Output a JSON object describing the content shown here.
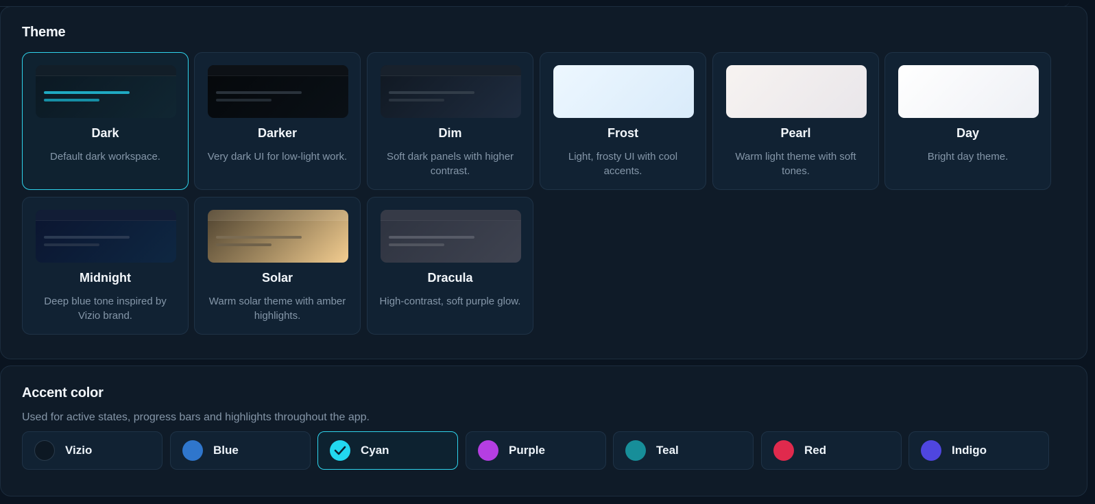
{
  "theme": {
    "title": "Theme",
    "selected": "Dark",
    "cards": [
      {
        "name": "Dark",
        "desc": "Default dark workspace.",
        "bg": "linear-gradient(135deg,#0b1822,#102632)",
        "bar": "#121e28",
        "line": "#1fa9c2",
        "line2": "#168ea5"
      },
      {
        "name": "Darker",
        "desc": "Very dark UI for low-light work.",
        "bg": "linear-gradient(135deg,#05080b,#0a1016)",
        "bar": "#0d1116",
        "line": "#2a323b",
        "line2": "#232b33"
      },
      {
        "name": "Dim",
        "desc": "Soft dark panels with higher contrast.",
        "bg": "linear-gradient(135deg,#101822,#1f2c3f)",
        "bar": "#18212c",
        "line": "#323d49",
        "line2": "#2a3440"
      },
      {
        "name": "Frost",
        "desc": "Light, frosty UI with cool accents.",
        "bg": "linear-gradient(135deg,#edf7ff,#d9ebfa)",
        "bar": "transparent",
        "line": "transparent",
        "line2": "transparent"
      },
      {
        "name": "Pearl",
        "desc": "Warm light theme with soft tones.",
        "bg": "linear-gradient(135deg,#f7f3f1,#e9e6ea)",
        "bar": "transparent",
        "line": "transparent",
        "line2": "transparent"
      },
      {
        "name": "Day",
        "desc": "Bright day theme.",
        "bg": "linear-gradient(135deg,#ffffff,#eef0f5)",
        "bar": "transparent",
        "line": "transparent",
        "line2": "transparent"
      },
      {
        "name": "Midnight",
        "desc": "Deep blue tone inspired by Vizio brand.",
        "bg": "linear-gradient(135deg,#0b1530,#0e2742)",
        "bar": "#121d36",
        "line": "#2b3a52",
        "line2": "#253248"
      },
      {
        "name": "Solar",
        "desc": "Warm solar theme with amber highlights.",
        "bg": "linear-gradient(135deg,#4f4330,#a58c62 55%,#f3cd90)",
        "bar": "rgba(255,240,210,0.10)",
        "line": "#7b6c53",
        "line2": "#6f614a"
      },
      {
        "name": "Dracula",
        "desc": "High-contrast, soft purple glow.",
        "bg": "linear-gradient(135deg,#2e3340,#3f4350)",
        "bar": "#363a47",
        "line": "#575b67",
        "line2": "#51555f"
      }
    ]
  },
  "accent": {
    "title": "Accent color",
    "description": "Used for active states, progress bars and highlights throughout the app.",
    "selected": "Cyan",
    "options": [
      {
        "name": "Vizio",
        "color": "#0d1823"
      },
      {
        "name": "Blue",
        "color": "#2f76cc"
      },
      {
        "name": "Cyan",
        "color": "#22d8f0"
      },
      {
        "name": "Purple",
        "color": "#b53ee2"
      },
      {
        "name": "Teal",
        "color": "#178e99"
      },
      {
        "name": "Red",
        "color": "#e02a4d"
      },
      {
        "name": "Indigo",
        "color": "#4f46e0"
      }
    ]
  }
}
